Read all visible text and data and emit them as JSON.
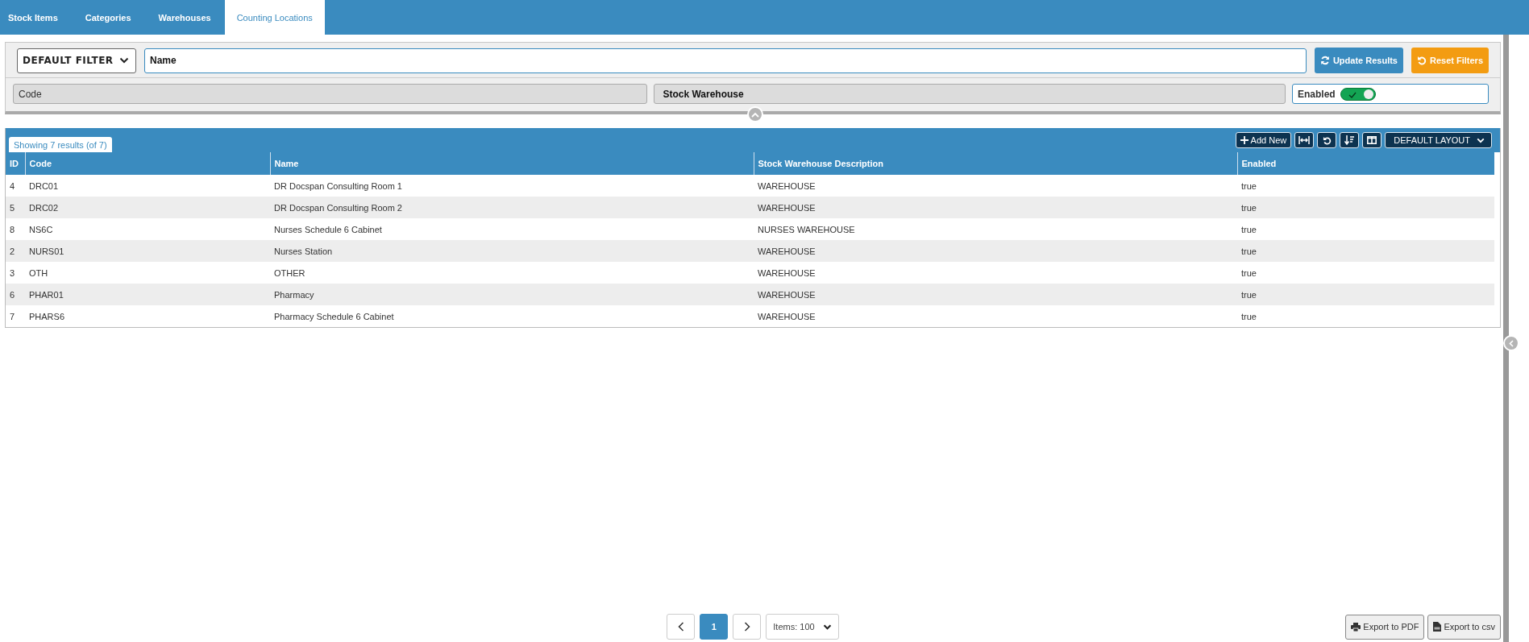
{
  "tabs": [
    {
      "label": "Stock Items",
      "selected": false
    },
    {
      "label": "Categories",
      "selected": false
    },
    {
      "label": "Warehouses",
      "selected": false
    },
    {
      "label": "Counting Locations",
      "selected": true
    }
  ],
  "filter": {
    "preset": "DEFAULT FILTER",
    "name_field": {
      "placeholder": "Name"
    },
    "code_field": {
      "placeholder": "Code"
    },
    "warehouse_field": {
      "placeholder": "Stock Warehouse"
    },
    "enabled_toggle": {
      "label": "Enabled",
      "on": true
    },
    "buttons": [
      {
        "kind": "update",
        "label": "Update Results"
      },
      {
        "kind": "reset",
        "label": "Reset Filters"
      }
    ]
  },
  "results": {
    "summary": "Showing 7 results (of 7)",
    "add_button": "Add New",
    "layout_menu": "DEFAULT LAYOUT"
  },
  "table": {
    "columns": [
      "ID",
      "Code",
      "Name",
      "Stock Warehouse Description",
      "Enabled"
    ],
    "rows": [
      [
        "4",
        "DRC01",
        "DR Docspan Consulting Room 1",
        "WAREHOUSE",
        "true"
      ],
      [
        "5",
        "DRC02",
        "DR Docspan Consulting Room 2",
        "WAREHOUSE",
        "true"
      ],
      [
        "8",
        "NS6C",
        "Nurses Schedule 6 Cabinet",
        "NURSES WAREHOUSE",
        "true"
      ],
      [
        "2",
        "NURS01",
        "Nurses Station",
        "WAREHOUSE",
        "true"
      ],
      [
        "3",
        "OTH",
        "OTHER",
        "WAREHOUSE",
        "true"
      ],
      [
        "6",
        "PHAR01",
        "Pharmacy",
        "WAREHOUSE",
        "true"
      ],
      [
        "7",
        "PHARS6",
        "Pharmacy Schedule 6 Cabinet",
        "WAREHOUSE",
        "true"
      ]
    ]
  },
  "pagination": {
    "pages": [
      {
        "label": "1",
        "selected": true
      }
    ],
    "page_size": "Items: 100"
  },
  "exports": [
    {
      "kind": "pdf",
      "label": "Export to PDF"
    },
    {
      "kind": "csv",
      "label": "Export to csv"
    }
  ]
}
